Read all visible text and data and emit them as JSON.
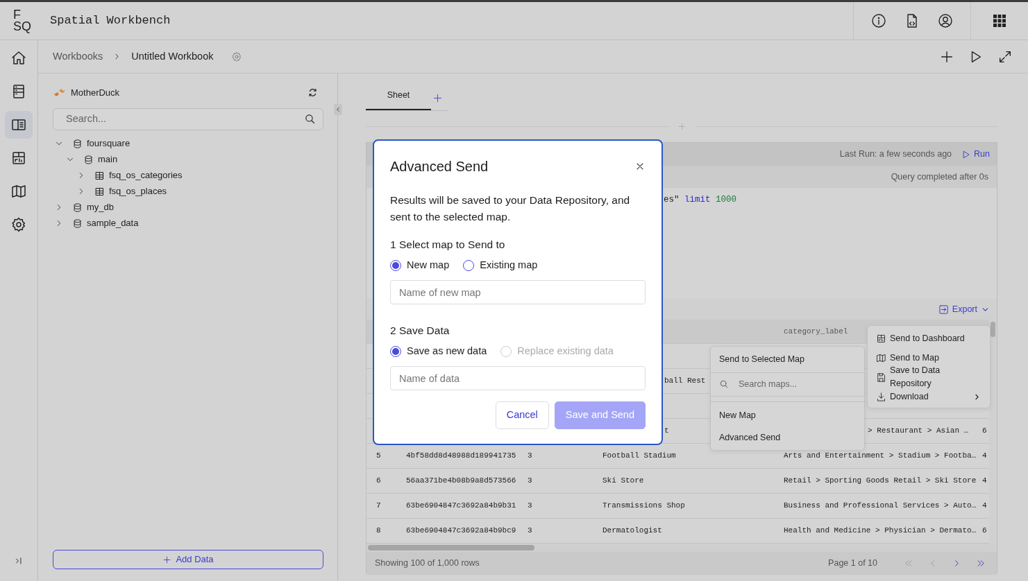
{
  "header": {
    "logo": [
      "F",
      "SQ"
    ],
    "title": "Spatial Workbench"
  },
  "rail": {
    "items": [
      {
        "kind": "home",
        "selected": false
      },
      {
        "kind": "data",
        "selected": false
      },
      {
        "kind": "panel",
        "selected": true
      },
      {
        "kind": "dashboard",
        "selected": false
      },
      {
        "kind": "map",
        "selected": false
      },
      {
        "kind": "settings",
        "selected": false
      }
    ]
  },
  "breadcrumb": [
    "Workbooks",
    "Untitled Workbook"
  ],
  "left_panel": {
    "source": "MotherDuck",
    "search_placeholder": "Search...",
    "tree": [
      {
        "label": "foursquare",
        "kind": "database",
        "expanded": true,
        "children": [
          {
            "label": "main",
            "kind": "schema",
            "expanded": true,
            "children": [
              {
                "label": "fsq_os_categories",
                "kind": "table",
                "expanded": false
              },
              {
                "label": "fsq_os_places",
                "kind": "table",
                "expanded": false
              }
            ]
          }
        ]
      },
      {
        "label": "my_db",
        "kind": "database",
        "expanded": false
      },
      {
        "label": "sample_data",
        "kind": "database",
        "expanded": false
      }
    ],
    "add_button": "Add Data"
  },
  "sheet_tabs": [
    {
      "label": "Sheet",
      "selected": true
    }
  ],
  "query": {
    "last_run": "Last Run: a few seconds ago",
    "run_label": "Run",
    "status": "Query completed after 0s",
    "code": [
      {
        "text": "es\"",
        "kind": "string"
      },
      {
        "text": "limit",
        "kind": "keyword"
      },
      {
        "text": "1000",
        "kind": "number"
      }
    ]
  },
  "results": {
    "export_label": "Export",
    "table": {
      "heading": "category_label",
      "rows": [
        {},
        {
          "column_4": "ball Rest"
        },
        {},
        {
          "column_4": "t",
          "category_label": "> Restaurant > Asian …",
          "column_6": "6"
        },
        {
          "column_1": "5",
          "column_2": "4bf58dd8d48988d189941735",
          "column_3": "3",
          "column_4": "Football Stadium",
          "category_label": "Arts and Entertainment > Stadium > Footba…",
          "column_6": "4"
        },
        {
          "column_1": "6",
          "column_2": "56aa371be4b08b9a8d573566",
          "column_3": "3",
          "column_4": "Ski Store",
          "category_label": "Retail > Sporting Goods Retail > Ski Store",
          "column_6": "4"
        },
        {
          "column_1": "7",
          "column_2": "63be6904847c3692a84b9b31",
          "column_3": "3",
          "column_4": "Transmissions Shop",
          "category_label": "Business and Professional Services > Auto…",
          "column_6": "4"
        },
        {
          "column_1": "8",
          "column_2": "63be6904847c3692a84b9bc9",
          "column_3": "3",
          "column_4": "Dermatologist",
          "category_label": "Health and Medicine > Physician > Dermato…",
          "column_6": "6"
        }
      ]
    },
    "footer": {
      "showing": "Showing 100 of 1,000 rows",
      "page": "Page 1 of 10",
      "pager": [
        {
          "kind": "first",
          "disabled": true
        },
        {
          "kind": "prev",
          "disabled": true
        },
        {
          "kind": "next",
          "disabled": false
        },
        {
          "kind": "last",
          "disabled": false
        }
      ]
    }
  },
  "modal": {
    "title": "Advanced Send",
    "description": "Results will be saved to your Data Repository, and sent to the selected map.",
    "sections": [
      {
        "heading": "1 Select map to Send to",
        "options": [
          {
            "label": "New map",
            "selected": true,
            "disabled": false
          },
          {
            "label": "Existing map",
            "selected": false,
            "disabled": false
          }
        ],
        "placeholder": "Name of new map"
      },
      {
        "heading": "2 Save Data",
        "options": [
          {
            "label": "Save as new data",
            "selected": true,
            "disabled": false
          },
          {
            "label": "Replace existing data",
            "selected": false,
            "disabled": true
          }
        ],
        "placeholder": "Name of data"
      }
    ],
    "buttons": [
      {
        "label": "Cancel",
        "kind": "secondary",
        "disabled": false
      },
      {
        "label": "Save and Send",
        "kind": "primary",
        "disabled": true
      }
    ]
  },
  "map_menu": {
    "title": "Send to Selected Map",
    "search_placeholder": "Search maps...",
    "items": [
      "New Map",
      "Advanced Send"
    ]
  },
  "export_menu": [
    {
      "kind": "dashboard",
      "label": "Send to Dashboard",
      "submenu": false
    },
    {
      "kind": "map",
      "label": "Send to Map",
      "submenu": false
    },
    {
      "kind": "save",
      "label": "Save to Data Repository",
      "submenu": false
    },
    {
      "kind": "download",
      "label": "Download",
      "submenu": true
    }
  ]
}
